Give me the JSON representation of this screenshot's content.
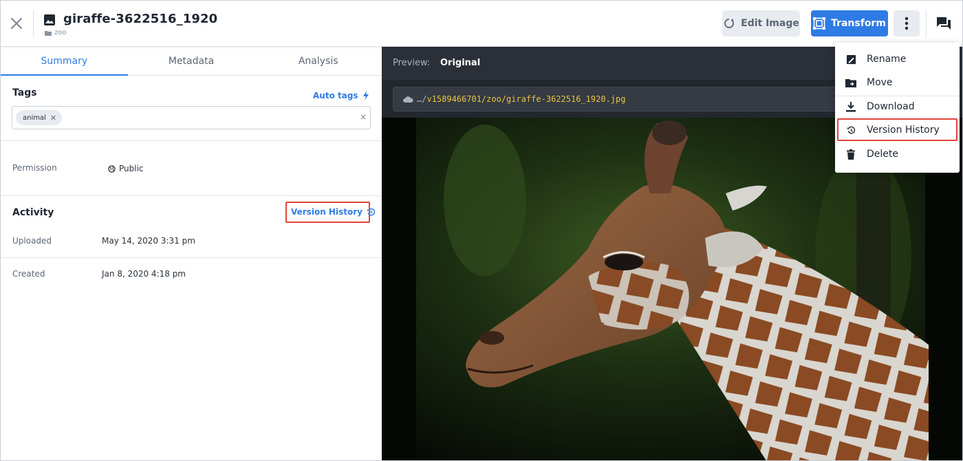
{
  "header": {
    "title": "giraffe-3622516_1920",
    "folder": "zoo",
    "edit_image_label": "Edit Image",
    "transform_label": "Transform"
  },
  "tabs": [
    {
      "label": "Summary",
      "active": true
    },
    {
      "label": "Metadata",
      "active": false
    },
    {
      "label": "Analysis",
      "active": false
    }
  ],
  "tags": {
    "title": "Tags",
    "auto_tags_label": "Auto tags",
    "chips": [
      "animal"
    ],
    "clear_symbol": "×"
  },
  "permission": {
    "label": "Permission",
    "value": "Public"
  },
  "activity": {
    "title": "Activity",
    "version_history_label": "Version History",
    "uploaded_label": "Uploaded",
    "uploaded_value": "May 14, 2020 3:31 pm",
    "created_label": "Created",
    "created_value": "Jan 8, 2020 4:18 pm"
  },
  "preview": {
    "label": "Preview:",
    "value": "Original",
    "url_prefix": "…/",
    "url_path": "v1589466701/zoo/giraffe-3622516_1920.jpg"
  },
  "menu": {
    "items": [
      {
        "label": "Rename",
        "icon": "rename-icon"
      },
      {
        "label": "Move",
        "icon": "folder-move-icon"
      },
      {
        "label": "Download",
        "icon": "download-icon"
      },
      {
        "label": "Version History",
        "icon": "history-icon",
        "highlighted": true
      },
      {
        "label": "Delete",
        "icon": "trash-icon"
      }
    ]
  },
  "colors": {
    "accent": "#2f7be5",
    "highlight": "#e0443a",
    "preview_bg": "#23272e",
    "url_text": "#e8c542"
  }
}
